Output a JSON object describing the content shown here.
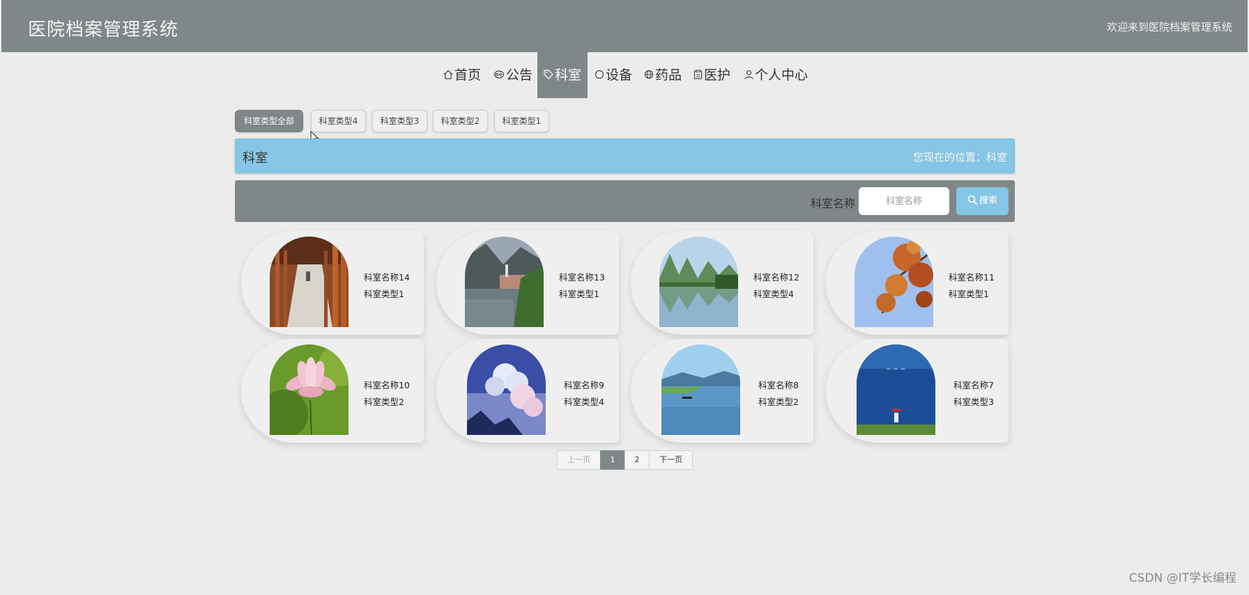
{
  "header": {
    "app_title": "医院档案管理系统",
    "welcome": "欢迎来到医院档案管理系统"
  },
  "nav": [
    {
      "label": "首页",
      "icon": "home-icon"
    },
    {
      "label": "公告",
      "icon": "announcement-icon"
    },
    {
      "label": "科室",
      "icon": "tag-icon",
      "active": true
    },
    {
      "label": "设备",
      "icon": "circle-icon"
    },
    {
      "label": "药品",
      "icon": "globe-icon"
    },
    {
      "label": "医护",
      "icon": "clipboard-icon"
    },
    {
      "label": "个人中心",
      "icon": "user-icon"
    }
  ],
  "filters": [
    "科室类型全部",
    "科室类型4",
    "科室类型3",
    "科室类型2",
    "科室类型1"
  ],
  "location": {
    "title": "科室",
    "path": "您现在的位置：科室"
  },
  "search": {
    "label": "科室名称",
    "placeholder": "科室名称",
    "button": "搜索"
  },
  "cards": [
    {
      "name": "科室名称14",
      "type": "科室类型1",
      "image": "wooden-corridor"
    },
    {
      "name": "科室名称13",
      "type": "科室类型1",
      "image": "lakeside-village"
    },
    {
      "name": "科室名称12",
      "type": "科室类型4",
      "image": "karst-river"
    },
    {
      "name": "科室名称11",
      "type": "科室类型1",
      "image": "autumn-leaves"
    },
    {
      "name": "科室名称10",
      "type": "科室类型2",
      "image": "lotus-flower"
    },
    {
      "name": "科室名称9",
      "type": "科室类型4",
      "image": "cloudy-sky"
    },
    {
      "name": "科室名称8",
      "type": "科室类型2",
      "image": "lake-boat"
    },
    {
      "name": "科室名称7",
      "type": "科室类型3",
      "image": "blue-lake-umbrella"
    }
  ],
  "pagination": {
    "prev": "上一页",
    "pages": [
      "1",
      "2"
    ],
    "current": "1",
    "next": "下一页"
  },
  "watermark": "CSDN @IT学长编程",
  "colors": {
    "header_bg": "#808789",
    "accent_blue": "#85c5e5",
    "page_bg": "#ececec"
  }
}
